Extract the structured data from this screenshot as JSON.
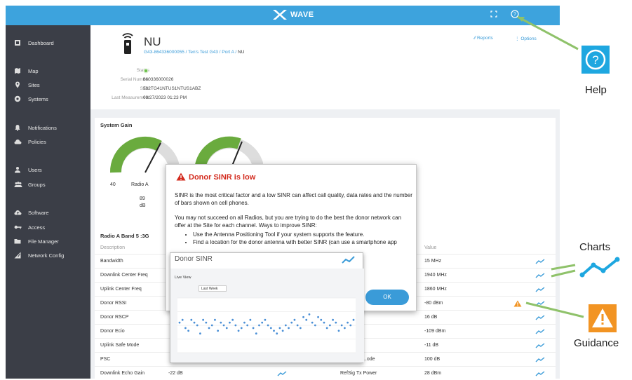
{
  "app": {
    "brand": "WAVE"
  },
  "sidebar": {
    "items": [
      {
        "label": "Dashboard",
        "icon": "dashboard-icon"
      },
      {
        "label": "Map",
        "icon": "map-icon"
      },
      {
        "label": "Sites",
        "icon": "location-pin-icon"
      },
      {
        "label": "Systems",
        "icon": "systems-icon"
      },
      {
        "label": "Notifications",
        "icon": "bell-icon"
      },
      {
        "label": "Policies",
        "icon": "cloud-icon"
      },
      {
        "label": "Users",
        "icon": "user-icon"
      },
      {
        "label": "Groups",
        "icon": "group-icon"
      },
      {
        "label": "Software",
        "icon": "cloud-upload-icon"
      },
      {
        "label": "Access",
        "icon": "key-icon"
      },
      {
        "label": "File Manager",
        "icon": "folder-icon"
      },
      {
        "label": "Network Config",
        "icon": "network-config-icon"
      }
    ]
  },
  "device": {
    "title": "NU",
    "breadcrumb": [
      "G43-864336000055",
      "Ten's Test G43",
      "Port A",
      "NU"
    ],
    "fields": [
      {
        "key": "Status",
        "value": ""
      },
      {
        "key": "Serial Number",
        "value": "860336000026"
      },
      {
        "key": "SKU",
        "value": "592TG41NTUS1NTUS1ABZ"
      },
      {
        "key": "Last Measurement",
        "value": "09/27/2023 01:23 PM"
      }
    ],
    "status_color": "#6cc04a"
  },
  "header_actions": {
    "reports": "Reports",
    "options": "Options"
  },
  "system_gain": {
    "title": "System Gain",
    "gauge1": {
      "min_label": "40",
      "name": "Radio A",
      "value": "89",
      "unit": "dB",
      "level": 0.62
    },
    "gauge2": {
      "level": 0.55
    }
  },
  "table": {
    "title": "Radio A Band 5 :3G",
    "left_header": "Description",
    "right_header": "Value",
    "left_rows": [
      "Bandwidth",
      "Downlink Center Freq",
      "Uplink Center Freq",
      "Donor RSSI",
      "Donor RSCP",
      "Donor Ecio",
      "Uplink Safe Mode",
      "PSC",
      "Downlink Echo Gain"
    ],
    "right_values": [
      "15 MHz",
      "1940 MHz",
      "1860 MHz",
      "-80 dBm",
      "16 dB",
      "-109 dBm",
      "-11 dB",
      "100 dB",
      "28 dBm"
    ],
    "left_last_value": "-22 dB",
    "right_partial_labels": {
      "row8": "...ode",
      "row9": "RefSig Tx Power"
    }
  },
  "dialog": {
    "title": "Donor SINR is low",
    "p1": "SINR is the most critical factor and a low SINR can affect call quality, data rates and the number of bars shown on cell phones.",
    "p2": "You may not succeed on all Radios, but you are trying to do the best the donor network can offer at the Site for each channel. Ways to improve SINR:",
    "bullets": [
      "Use the Antenna Positioning Tool if your system supports the feature.",
      "Find a location for the donor antenna with better SINR (can use a smartphone app"
    ],
    "ok_label": "OK",
    "warning_color": "#d32b1e"
  },
  "chart_popup": {
    "title": "Donor SINR",
    "subtitle": "Live View",
    "range_label": "Last Week"
  },
  "chart_data": {
    "type": "scatter",
    "title": "Donor SINR",
    "x": [
      1,
      2,
      3,
      4,
      5,
      6,
      7,
      8,
      9,
      10,
      11,
      12,
      13,
      14,
      15,
      16,
      17,
      18,
      19,
      20,
      21,
      22,
      23,
      24,
      25,
      26,
      27,
      28,
      29,
      30,
      31,
      32,
      33,
      34,
      35,
      36,
      37,
      38,
      39,
      40,
      41,
      42,
      43,
      44,
      45,
      46,
      47,
      48,
      49,
      50,
      51,
      52,
      53,
      54,
      55,
      56,
      57,
      58,
      59,
      60
    ],
    "y": [
      11,
      12,
      9,
      8,
      12,
      11,
      10,
      7,
      12,
      11,
      9,
      10,
      12,
      8,
      11,
      10,
      9,
      11,
      12,
      10,
      8,
      9,
      11,
      10,
      12,
      9,
      7,
      10,
      11,
      12,
      10,
      9,
      8,
      7,
      9,
      8,
      10,
      9,
      11,
      12,
      10,
      9,
      13,
      12,
      14,
      11,
      10,
      13,
      12,
      11,
      9,
      10,
      12,
      11,
      8,
      10,
      9,
      11,
      10,
      12
    ],
    "ylim": [
      0,
      20
    ]
  },
  "callouts": {
    "help": "Help",
    "charts": "Charts",
    "guidance": "Guidance"
  },
  "colors": {
    "accent": "#3da3dd",
    "sidebar": "#3b3e47",
    "callout_green": "#8fc26a",
    "guidance_orange": "#f29423",
    "gauge_green": "#6aab3e"
  }
}
